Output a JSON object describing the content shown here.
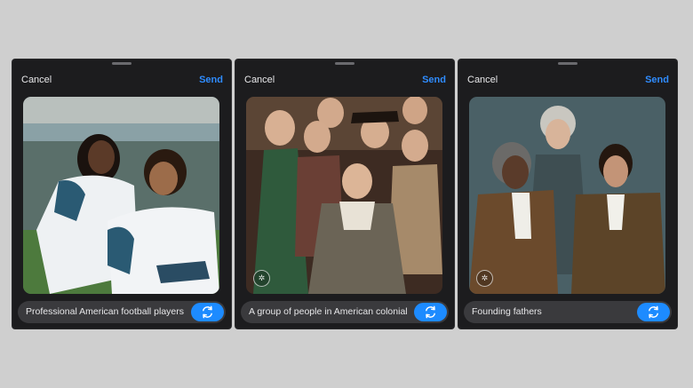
{
  "panels": [
    {
      "cancel_label": "Cancel",
      "send_label": "Send",
      "prompt_text": "Professional American football players",
      "image_alt": "football-players-image",
      "has_watermark": false
    },
    {
      "cancel_label": "Cancel",
      "send_label": "Send",
      "prompt_text": "A group of people in American colonial",
      "image_alt": "colonial-group-image",
      "has_watermark": true
    },
    {
      "cancel_label": "Cancel",
      "send_label": "Send",
      "prompt_text": "Founding fathers",
      "image_alt": "founding-fathers-image",
      "has_watermark": true
    }
  ],
  "icons": {
    "regenerate": "refresh-icon",
    "watermark": "ai-watermark-icon"
  },
  "colors": {
    "accent": "#1d8bff",
    "send": "#2f8cff",
    "panel_bg": "#1c1c1e",
    "prompt_bg": "#3a3a3d",
    "page_bg": "#cfcfcf"
  }
}
